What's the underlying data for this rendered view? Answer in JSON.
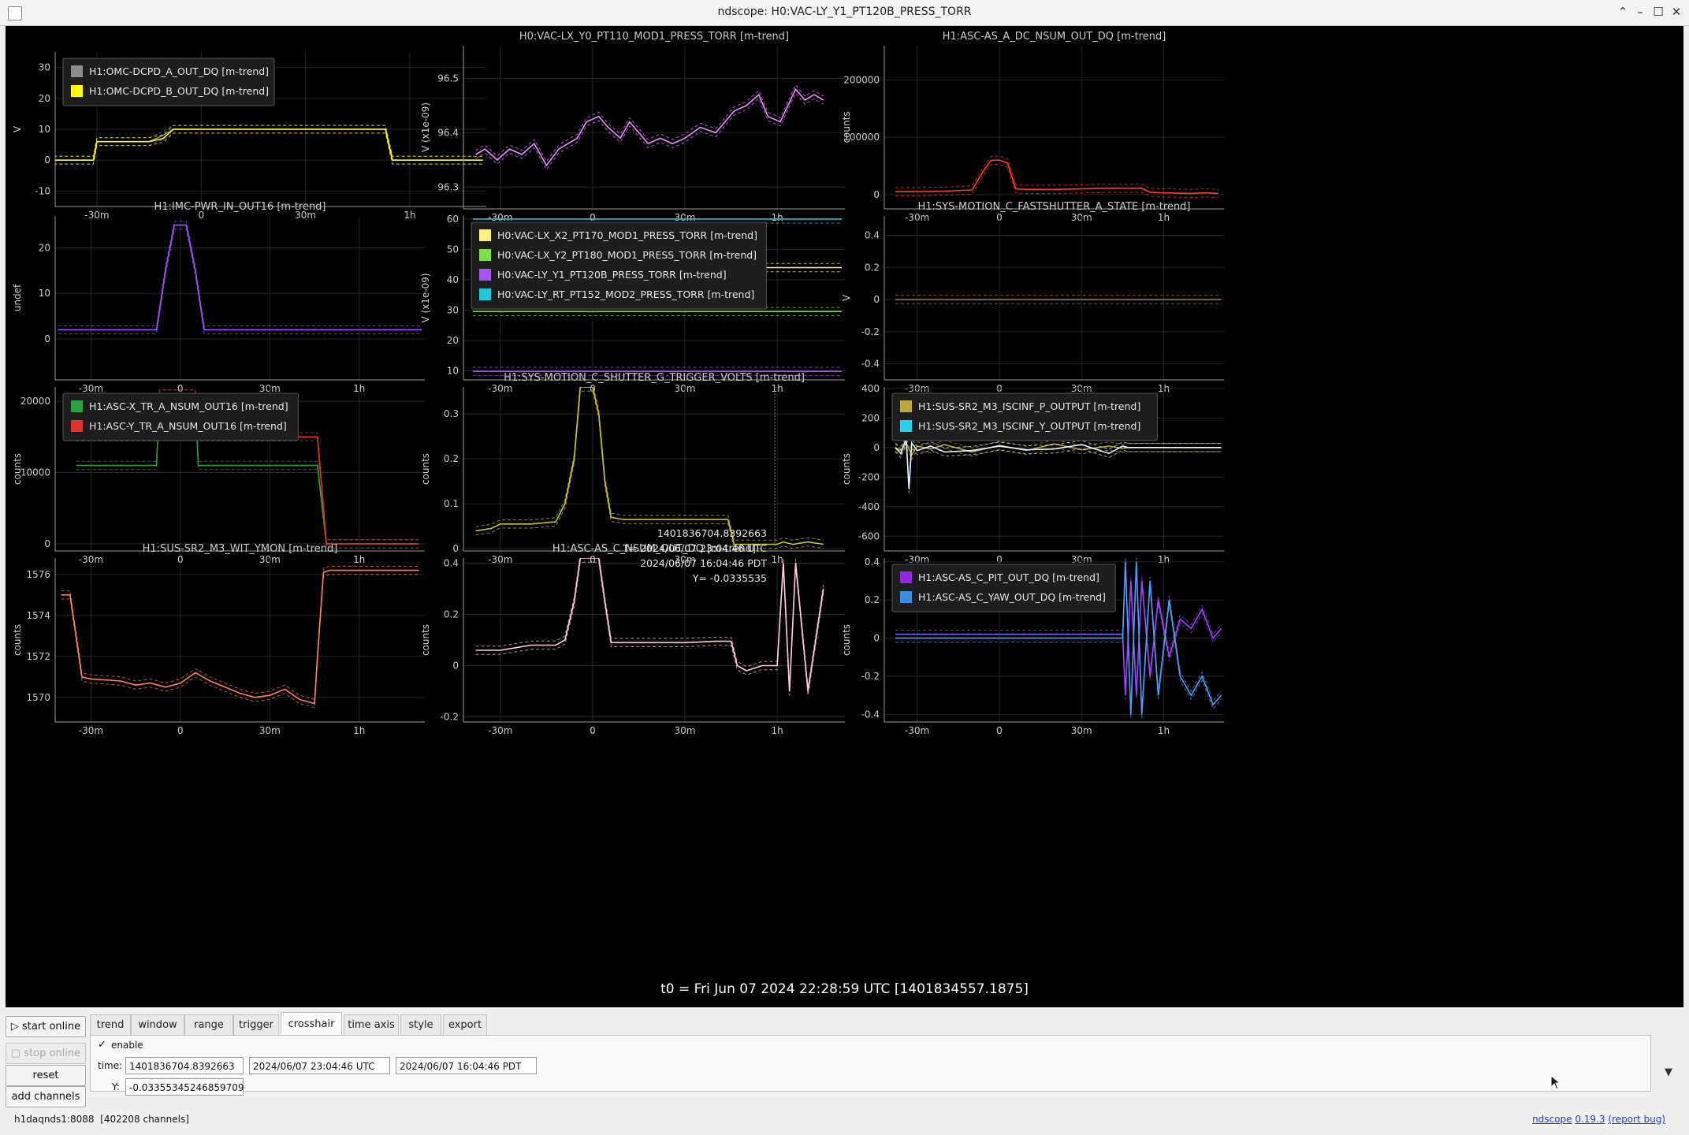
{
  "window": {
    "title": "ndscope: H0:VAC-LY_Y1_PT120B_PRESS_TORR"
  },
  "t0_label": "t0 = Fri Jun 07 2024 22:28:59 UTC [1401834557.1875]",
  "left_buttons": {
    "start_online": "start online",
    "stop_online": "stop online",
    "reset": "reset",
    "add_channels": "add channels"
  },
  "tabs": [
    "trend",
    "window",
    "range",
    "trigger",
    "crosshair",
    "time axis",
    "style",
    "export"
  ],
  "active_tab": "crosshair",
  "crosshair": {
    "enable_label": "enable",
    "enabled": true,
    "time_label": "time:",
    "time_gps": "1401836704.8392663",
    "time_utc": "2024/06/07 23:04:46 UTC",
    "time_local": "2024/06/07 16:04:46 PDT",
    "y_label": "Y:",
    "y_value": "-0.03355345246859709"
  },
  "status": {
    "server": "h1daqnds1:8088",
    "channels": "[402208 channels]"
  },
  "about": {
    "name": "ndscope",
    "version": "0.19.3",
    "report": "(report bug)"
  },
  "crosshair_readout": [
    "1401836704.8392663",
    "T= 2024/06/07 23:04:46 UTC",
    "2024/06/07 16:04:46 PDT",
    "Y= -0.0335535"
  ],
  "colors": {
    "plot_background": "#000000",
    "grid": "#262626",
    "axis_text": "#cccccc",
    "gap_line": "#d01010"
  },
  "chart_data": [
    {
      "type": "line",
      "title": "",
      "ylabel": "V",
      "ylim": [
        -15,
        35
      ],
      "yticks": [
        30,
        20,
        10,
        0,
        -10
      ],
      "xticks": [
        "-30m",
        "0",
        "30m",
        "1h"
      ],
      "legend": [
        {
          "name": "H1:OMC-DCPD_A_OUT_DQ [m-trend]",
          "color": "#8c8c8c"
        },
        {
          "name": "H1:OMC-DCPD_B_OUT_DQ [m-trend]",
          "color": "#ffff00"
        }
      ],
      "series": [
        {
          "name": "H1:OMC-DCPD_A_OUT_DQ [m-trend]",
          "color": "#8c8c8c",
          "x": [
            -44,
            -33,
            -31,
            -30,
            -27,
            -15,
            -11,
            -8,
            -5,
            -2,
            0,
            20,
            38,
            40,
            47,
            53,
            55,
            58,
            65,
            75,
            81
          ],
          "y": [
            0,
            0,
            0,
            6,
            6,
            6,
            8,
            10,
            10,
            10,
            10,
            10,
            10,
            10,
            10,
            10,
            0,
            0,
            0,
            0,
            0
          ]
        },
        {
          "name": "H1:OMC-DCPD_B_OUT_DQ [m-trend]",
          "color": "#ffff00",
          "x": [
            -44,
            -33,
            -31,
            -30,
            -27,
            -15,
            -11,
            -8,
            -5,
            -2,
            0,
            20,
            38,
            40,
            47,
            53,
            55,
            58,
            65,
            75,
            81
          ],
          "y": [
            0,
            0,
            0,
            6,
            6,
            6,
            7,
            10,
            10,
            10,
            10,
            10,
            10,
            10,
            10,
            10,
            0,
            0,
            0,
            0,
            0
          ]
        }
      ]
    },
    {
      "type": "line",
      "title": "H0:VAC-LX_Y0_PT110_MOD1_PRESS_TORR [m-trend]",
      "ylabel": "V (x1e-09)",
      "ylim": [
        96.26,
        96.56
      ],
      "yticks": [
        96.5,
        96.4,
        96.3
      ],
      "xticks": [
        "-30m",
        "0",
        "30m",
        "1h"
      ],
      "legend": [],
      "series": [
        {
          "name": "",
          "color": "#e890ff",
          "x": [
            -38,
            -35,
            -31,
            -27,
            -23,
            -19,
            -15,
            -11,
            -8,
            -5,
            -2,
            2,
            5,
            9,
            12,
            15,
            18,
            22,
            26,
            30,
            35,
            40,
            43,
            46,
            50,
            54,
            57,
            61,
            66,
            69,
            72,
            75
          ],
          "y": [
            96.36,
            96.37,
            96.35,
            96.37,
            96.36,
            96.38,
            96.34,
            96.37,
            96.38,
            96.39,
            96.42,
            96.43,
            96.41,
            96.39,
            96.42,
            96.4,
            96.38,
            96.39,
            96.38,
            96.39,
            96.41,
            96.4,
            96.42,
            96.44,
            96.45,
            96.47,
            96.43,
            96.42,
            96.48,
            96.46,
            96.47,
            96.46
          ]
        }
      ]
    },
    {
      "type": "line",
      "title": "H1:ASC-AS_A_DC_NSUM_OUT_DQ [m-trend]",
      "ylabel": "counts",
      "ylim": [
        -25000,
        260000
      ],
      "yticks": [
        200000,
        100000,
        0
      ],
      "xticks": [
        "-30m",
        "0",
        "30m",
        "1h"
      ],
      "legend": [],
      "series": [
        {
          "name": "",
          "color": "#ff3b2e",
          "x": [
            -38,
            -30,
            -20,
            -10,
            -6,
            -3,
            0,
            3,
            6,
            10,
            20,
            30,
            40,
            52,
            55,
            60,
            70,
            75,
            80
          ],
          "y": [
            5000,
            5000,
            6000,
            8000,
            40000,
            60000,
            60000,
            55000,
            10000,
            9000,
            9000,
            10000,
            11000,
            11000,
            4000,
            3000,
            2000,
            3000,
            2000
          ]
        }
      ]
    },
    {
      "type": "line",
      "title": "H1:IMC-PWR_IN_OUT16 [m-trend]",
      "ylabel": "undef",
      "ylim": [
        -9,
        27
      ],
      "yticks": [
        20,
        10,
        0
      ],
      "xticks": [
        "-30m",
        "0",
        "30m",
        "1h"
      ],
      "legend": [],
      "series": [
        {
          "name": "",
          "color": "#9955ff",
          "x": [
            -41,
            -30,
            -15,
            -8,
            -5,
            -2,
            2,
            5,
            8,
            15,
            30,
            45,
            60,
            75,
            81
          ],
          "y": [
            2,
            2,
            2,
            2,
            15,
            25,
            25,
            15,
            2,
            2,
            2,
            2,
            2,
            2,
            2
          ]
        }
      ]
    },
    {
      "type": "line",
      "title": "",
      "ylabel": "V (x1e-09)",
      "ylim": [
        7,
        61
      ],
      "yticks": [
        60,
        50,
        40,
        30,
        20,
        10
      ],
      "xticks": [
        "-30m",
        "0",
        "30m",
        "1h"
      ],
      "legend": [
        {
          "name": "H0:VAC-LX_X2_PT170_MOD1_PRESS_TORR [m-trend]",
          "color": "#fff27a"
        },
        {
          "name": "H0:VAC-LX_Y2_PT180_MOD1_PRESS_TORR [m-trend]",
          "color": "#7dde47"
        },
        {
          "name": "H0:VAC-LY_Y1_PT120B_PRESS_TORR [m-trend]",
          "color": "#a855f7"
        },
        {
          "name": "H0:VAC-LY_RT_PT152_MOD2_PRESS_TORR [m-trend]",
          "color": "#1ec8d8"
        }
      ],
      "series": [
        {
          "name": "H0:VAC-LX_X2_PT170_MOD1_PRESS_TORR [m-trend]",
          "color": "#fff27a",
          "x": [
            -39,
            81
          ],
          "y": [
            44,
            44
          ]
        },
        {
          "name": "H0:VAC-LX_Y2_PT180_MOD1_PRESS_TORR [m-trend]",
          "color": "#7dde47",
          "x": [
            -39,
            81
          ],
          "y": [
            29.5,
            29.5
          ]
        },
        {
          "name": "H0:VAC-LY_Y1_PT120B_PRESS_TORR [m-trend]",
          "color": "#a855f7",
          "x": [
            -39,
            81
          ],
          "y": [
            9.8,
            9.8
          ]
        },
        {
          "name": "H0:VAC-LY_RT_PT152_MOD2_PRESS_TORR [m-trend]",
          "color": "#1ec8d8",
          "x": [
            -39,
            81
          ],
          "y": [
            60,
            60
          ]
        }
      ]
    },
    {
      "type": "line",
      "title": "H1:SYS-MOTION_C_FASTSHUTTER_A_STATE [m-trend]",
      "ylabel": "V",
      "ylim": [
        -0.5,
        0.52
      ],
      "yticks": [
        0.4,
        0.2,
        0,
        -0.2,
        -0.4
      ],
      "xticks": [
        "-30m",
        "0",
        "30m",
        "1h"
      ],
      "legend": [],
      "series": [
        {
          "name": "",
          "color": "#9a8a30",
          "x": [
            -38,
            81
          ],
          "y": [
            0,
            0
          ]
        }
      ]
    },
    {
      "type": "line",
      "title": "",
      "ylabel": "counts",
      "ylim": [
        -1000,
        22000
      ],
      "yticks": [
        20000,
        10000,
        0
      ],
      "xticks": [
        "-30m",
        "0",
        "30m",
        "1h"
      ],
      "legend": [
        {
          "name": "H1:ASC-X_TR_A_NSUM_OUT16 [m-trend]",
          "color": "#2ea043"
        },
        {
          "name": "H1:ASC-Y_TR_A_NSUM_OUT16 [m-trend]",
          "color": "#e23030"
        }
      ],
      "series": [
        {
          "name": "H1:ASC-X_TR_A_NSUM_OUT16 [m-trend]",
          "color": "#2ea043",
          "x": [
            -35,
            -20,
            -8,
            -7,
            -6,
            -2,
            5,
            6,
            7,
            20,
            40,
            46,
            49,
            53,
            80
          ],
          "y": [
            11000,
            11000,
            11000,
            21000,
            21000,
            21000,
            21000,
            11000,
            11000,
            11000,
            11000,
            11000,
            0,
            0,
            0
          ]
        },
        {
          "name": "H1:ASC-Y_TR_A_NSUM_OUT16 [m-trend]",
          "color": "#e23030",
          "x": [
            -35,
            -20,
            -8,
            -7,
            -6,
            -2,
            5,
            6,
            7,
            20,
            40,
            46,
            49,
            53,
            80
          ],
          "y": [
            15000,
            15000,
            15000,
            21000,
            21000,
            21000,
            21000,
            15000,
            15000,
            15000,
            15000,
            15000,
            0,
            0,
            0
          ]
        }
      ]
    },
    {
      "type": "line",
      "title": "H1:SYS-MOTION_C_SHUTTER_G_TRIGGER_VOLTS [m-trend]",
      "ylabel": "counts",
      "ylim": [
        -0.005,
        0.36
      ],
      "yticks": [
        0.3,
        0.2,
        0.1,
        0
      ],
      "xticks": [
        "-30m",
        "0",
        "30m",
        "1h"
      ],
      "legend": [],
      "series": [
        {
          "name": "",
          "color": "#c8c820",
          "x": [
            -38,
            -33,
            -30,
            -20,
            -12,
            -9,
            -6,
            -4,
            -2,
            0,
            2,
            4,
            6,
            10,
            20,
            35,
            44,
            46,
            55,
            60,
            62,
            65,
            70,
            75
          ],
          "y": [
            0.04,
            0.045,
            0.055,
            0.055,
            0.06,
            0.1,
            0.2,
            0.36,
            0.36,
            0.36,
            0.3,
            0.15,
            0.07,
            0.065,
            0.065,
            0.065,
            0.065,
            0.01,
            0.01,
            0.01,
            0.015,
            0.01,
            0.015,
            0.01
          ]
        }
      ]
    },
    {
      "type": "line",
      "title": "",
      "ylabel": "counts",
      "ylim": [
        -700,
        410
      ],
      "yticks": [
        400,
        200,
        0,
        -200,
        -400,
        -600
      ],
      "xticks": [
        "-30m",
        "0",
        "30m",
        "1h"
      ],
      "legend": [
        {
          "name": "H1:SUS-SR2_M3_ISCINF_P_OUTPUT [m-trend]",
          "color": "#bba93f"
        },
        {
          "name": "H1:SUS-SR2_M3_ISCINF_Y_OUTPUT [m-trend]",
          "color": "#28d0e8"
        }
      ],
      "series": [
        {
          "name": "H1:SUS-SR2_M3_ISCINF_P_OUTPUT [m-trend]",
          "color": "#bba93f",
          "x": [
            -38,
            -36,
            -34,
            -32,
            -30,
            -25,
            -20,
            -10,
            0,
            10,
            20,
            30,
            40,
            45,
            47,
            55,
            70,
            81
          ],
          "y": [
            0,
            -20,
            30,
            -50,
            10,
            -10,
            20,
            -30,
            15,
            -20,
            25,
            -15,
            10,
            -5,
            0,
            0,
            0,
            0
          ]
        },
        {
          "name": "H1:SUS-SR2_M3_ISCINF_Y_OUTPUT [m-trend]",
          "color": "#e8f6ff",
          "x": [
            -38,
            -36,
            -34,
            -33,
            -32,
            -30,
            -25,
            -20,
            -10,
            0,
            10,
            20,
            30,
            40,
            45,
            47,
            55,
            70,
            81
          ],
          "y": [
            0,
            -40,
            60,
            -280,
            30,
            -20,
            10,
            -30,
            -20,
            10,
            -15,
            -10,
            20,
            -40,
            10,
            0,
            0,
            0,
            0
          ]
        }
      ]
    },
    {
      "type": "line",
      "title": "H1:SUS-SR2_M3_WIT_YMON [m-trend]",
      "ylabel": "counts",
      "ylim": [
        1568.8,
        1576.8
      ],
      "yticks": [
        1576,
        1574,
        1572,
        1570
      ],
      "xticks": [
        "-30m",
        "0",
        "30m",
        "1h"
      ],
      "legend": [],
      "series": [
        {
          "name": "",
          "color": "#ff8060",
          "x": [
            -40,
            -37,
            -35,
            -33,
            -30,
            -20,
            -15,
            -10,
            -5,
            0,
            5,
            10,
            15,
            20,
            25,
            30,
            35,
            40,
            45,
            46,
            48,
            50,
            60,
            70,
            80
          ],
          "y": [
            1575,
            1575,
            1573,
            1571,
            1570.9,
            1570.8,
            1570.6,
            1570.7,
            1570.5,
            1570.7,
            1571.2,
            1570.8,
            1570.5,
            1570.2,
            1570,
            1570.1,
            1570.4,
            1569.9,
            1569.7,
            1572,
            1576.1,
            1576.2,
            1576.2,
            1576.2,
            1576.2
          ]
        }
      ]
    },
    {
      "type": "line",
      "title": "H1:ASC-AS_C_NSUM_OUT_DQ [m-trend]",
      "ylabel": "counts",
      "ylim": [
        -0.22,
        0.42
      ],
      "yticks": [
        0.4,
        0.2,
        0,
        -0.2
      ],
      "xticks": [
        "-30m",
        "0",
        "30m",
        "1h"
      ],
      "legend": [],
      "series": [
        {
          "name": "",
          "color": "#ffd0d8",
          "x": [
            -38,
            -30,
            -25,
            -20,
            -12,
            -9,
            -6,
            -4,
            -2,
            2,
            4,
            6,
            10,
            20,
            30,
            40,
            45,
            47,
            50,
            55,
            60,
            62,
            64,
            66,
            70,
            75
          ],
          "y": [
            0.06,
            0.06,
            0.07,
            0.08,
            0.08,
            0.1,
            0.25,
            0.42,
            0.42,
            0.42,
            0.25,
            0.09,
            0.09,
            0.09,
            0.09,
            0.095,
            0.095,
            0,
            -0.02,
            0,
            0,
            0.4,
            -0.1,
            0.4,
            -0.1,
            0.3
          ]
        }
      ]
    },
    {
      "type": "line",
      "title": "",
      "ylabel": "counts",
      "ylim": [
        -0.44,
        0.42
      ],
      "yticks": [
        0.4,
        0.2,
        0,
        -0.2,
        -0.4
      ],
      "xticks": [
        "-30m",
        "0",
        "30m",
        "1h"
      ],
      "legend": [
        {
          "name": "H1:ASC-AS_C_PIT_OUT_DQ [m-trend]",
          "color": "#8a2be2"
        },
        {
          "name": "H1:ASC-AS_C_YAW_OUT_DQ [m-trend]",
          "color": "#3a8ee0"
        }
      ],
      "series": [
        {
          "name": "H1:ASC-AS_C_PIT_OUT_DQ [m-trend]",
          "color": "#a040ff",
          "x": [
            -38,
            -20,
            0,
            20,
            40,
            45,
            46,
            48,
            50,
            52,
            55,
            58,
            62,
            66,
            70,
            74,
            78,
            81
          ],
          "y": [
            0.02,
            0.02,
            0.02,
            0.02,
            0.02,
            0.02,
            -0.3,
            0.3,
            -0.3,
            0.3,
            -0.2,
            0.2,
            -0.1,
            0.1,
            0.05,
            0.15,
            0.0,
            0.05
          ]
        },
        {
          "name": "H1:ASC-AS_C_YAW_OUT_DQ [m-trend]",
          "color": "#4aa0ff",
          "x": [
            -38,
            -20,
            0,
            20,
            40,
            45,
            46,
            48,
            50,
            52,
            55,
            58,
            62,
            66,
            70,
            74,
            78,
            81
          ],
          "y": [
            0,
            0,
            0,
            0,
            0,
            0,
            0.4,
            -0.4,
            0.4,
            -0.4,
            0.3,
            -0.3,
            0.2,
            -0.2,
            -0.3,
            -0.2,
            -0.35,
            -0.3
          ]
        }
      ]
    }
  ]
}
